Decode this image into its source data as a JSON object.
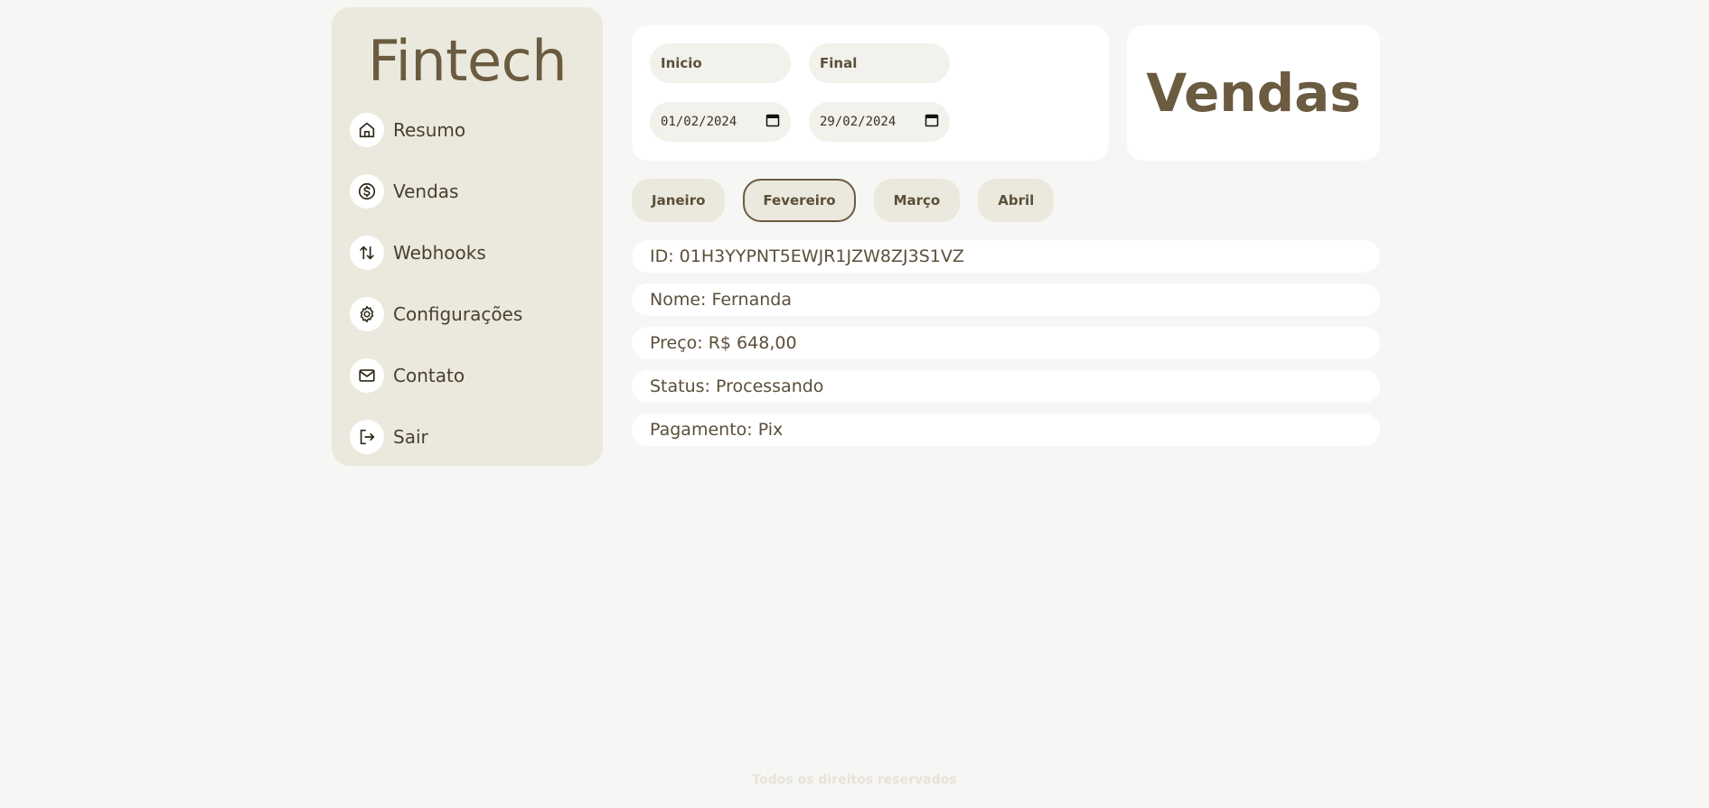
{
  "sidebar": {
    "brand": "Fintech",
    "items": [
      {
        "label": "Resumo",
        "icon": "home-icon"
      },
      {
        "label": "Vendas",
        "icon": "dollar-icon"
      },
      {
        "label": "Webhooks",
        "icon": "arrows-icon"
      },
      {
        "label": "Configurações",
        "icon": "gear-icon"
      },
      {
        "label": "Contato",
        "icon": "mail-icon"
      },
      {
        "label": "Sair",
        "icon": "logout-icon"
      }
    ]
  },
  "filters": {
    "start_label": "Inicio",
    "end_label": "Final",
    "start_value": "01/02/2024",
    "end_value": "29/02/2024"
  },
  "page_title": "Vendas",
  "months": [
    {
      "label": "Janeiro",
      "active": false
    },
    {
      "label": "Fevereiro",
      "active": true
    },
    {
      "label": "Março",
      "active": false
    },
    {
      "label": "Abril",
      "active": false
    }
  ],
  "sale": {
    "id": "ID: 01H3YYPNT5EWJR1JZW8ZJ3S1VZ",
    "nome": "Nome: Fernanda",
    "preco": "Preço: R$ 648,00",
    "status": "Status: Processando",
    "pagamento": "Pagamento: Pix"
  },
  "footer": "Todos os direitos reservados",
  "colors": {
    "background": "#f6f6f4",
    "sidebar": "#ebe9dd",
    "accent": "#6b5b40"
  }
}
